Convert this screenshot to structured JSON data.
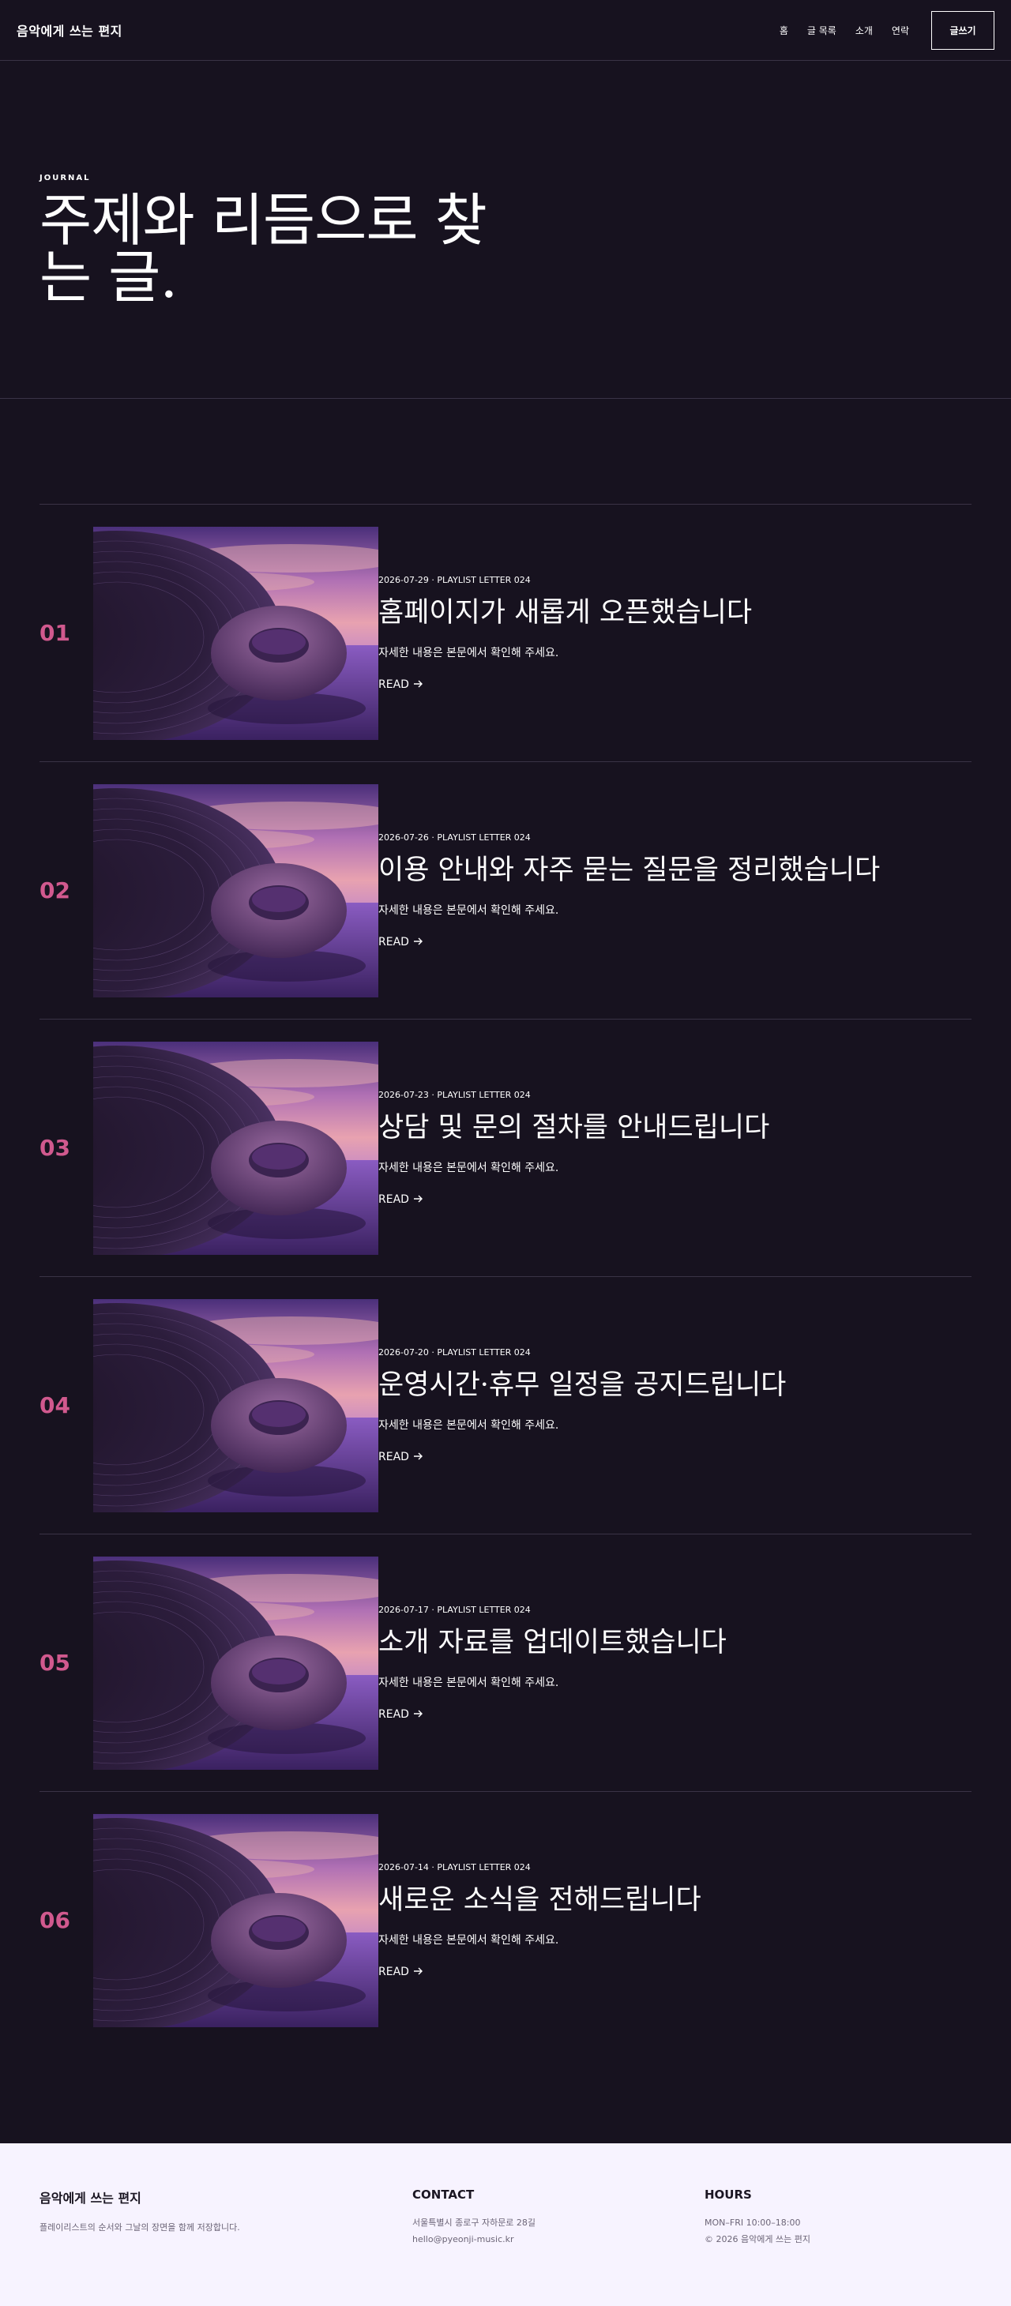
{
  "header": {
    "logo": "음악에게 쓰는 편지",
    "nav": [
      "홈",
      "글 목록",
      "소개",
      "연락"
    ],
    "write_button": "글쓰기"
  },
  "hero": {
    "eyebrow": "JOURNAL",
    "title": "주제와 리듬으로 찾는 글."
  },
  "posts": [
    {
      "num": "01",
      "meta": "2026-07-29 · PLAYLIST LETTER 024",
      "title": "홈페이지가 새롭게 오픈했습니다",
      "excerpt": "자세한 내용은 본문에서 확인해 주세요.",
      "read": "READ"
    },
    {
      "num": "02",
      "meta": "2026-07-26 · PLAYLIST LETTER 024",
      "title": "이용 안내와 자주 묻는 질문을 정리했습니다",
      "excerpt": "자세한 내용은 본문에서 확인해 주세요.",
      "read": "READ"
    },
    {
      "num": "03",
      "meta": "2026-07-23 · PLAYLIST LETTER 024",
      "title": "상담 및 문의 절차를 안내드립니다",
      "excerpt": "자세한 내용은 본문에서 확인해 주세요.",
      "read": "READ"
    },
    {
      "num": "04",
      "meta": "2026-07-20 · PLAYLIST LETTER 024",
      "title": "운영시간·휴무 일정을 공지드립니다",
      "excerpt": "자세한 내용은 본문에서 확인해 주세요.",
      "read": "READ"
    },
    {
      "num": "05",
      "meta": "2026-07-17 · PLAYLIST LETTER 024",
      "title": "소개 자료를 업데이트했습니다",
      "excerpt": "자세한 내용은 본문에서 확인해 주세요.",
      "read": "READ"
    },
    {
      "num": "06",
      "meta": "2026-07-14 · PLAYLIST LETTER 024",
      "title": "새로운 소식을 전해드립니다",
      "excerpt": "자세한 내용은 본문에서 확인해 주세요.",
      "read": "READ"
    }
  ],
  "footer": {
    "brand_title": "음악에게 쓰는 편지",
    "brand_desc": "플레이리스트의 순서와 그날의 장면을 함께 저장합니다.",
    "contact_heading": "CONTACT",
    "contact_address": "서울특별시 종로구 자하문로 28길",
    "contact_email": "hello@pyeonji-music.kr",
    "hours_heading": "HOURS",
    "hours_text": "MON–FRI 10:00–18:00",
    "copyright": "© 2026 음악에게 쓰는 편지"
  },
  "colors": {
    "background": "#17121f",
    "accent_number": "#d1598e",
    "footer_bg": "#f7f3ff"
  },
  "icons": {
    "read_arrow": "arrow-right-icon",
    "thumbnail": "vinyl-record-donut-image"
  }
}
